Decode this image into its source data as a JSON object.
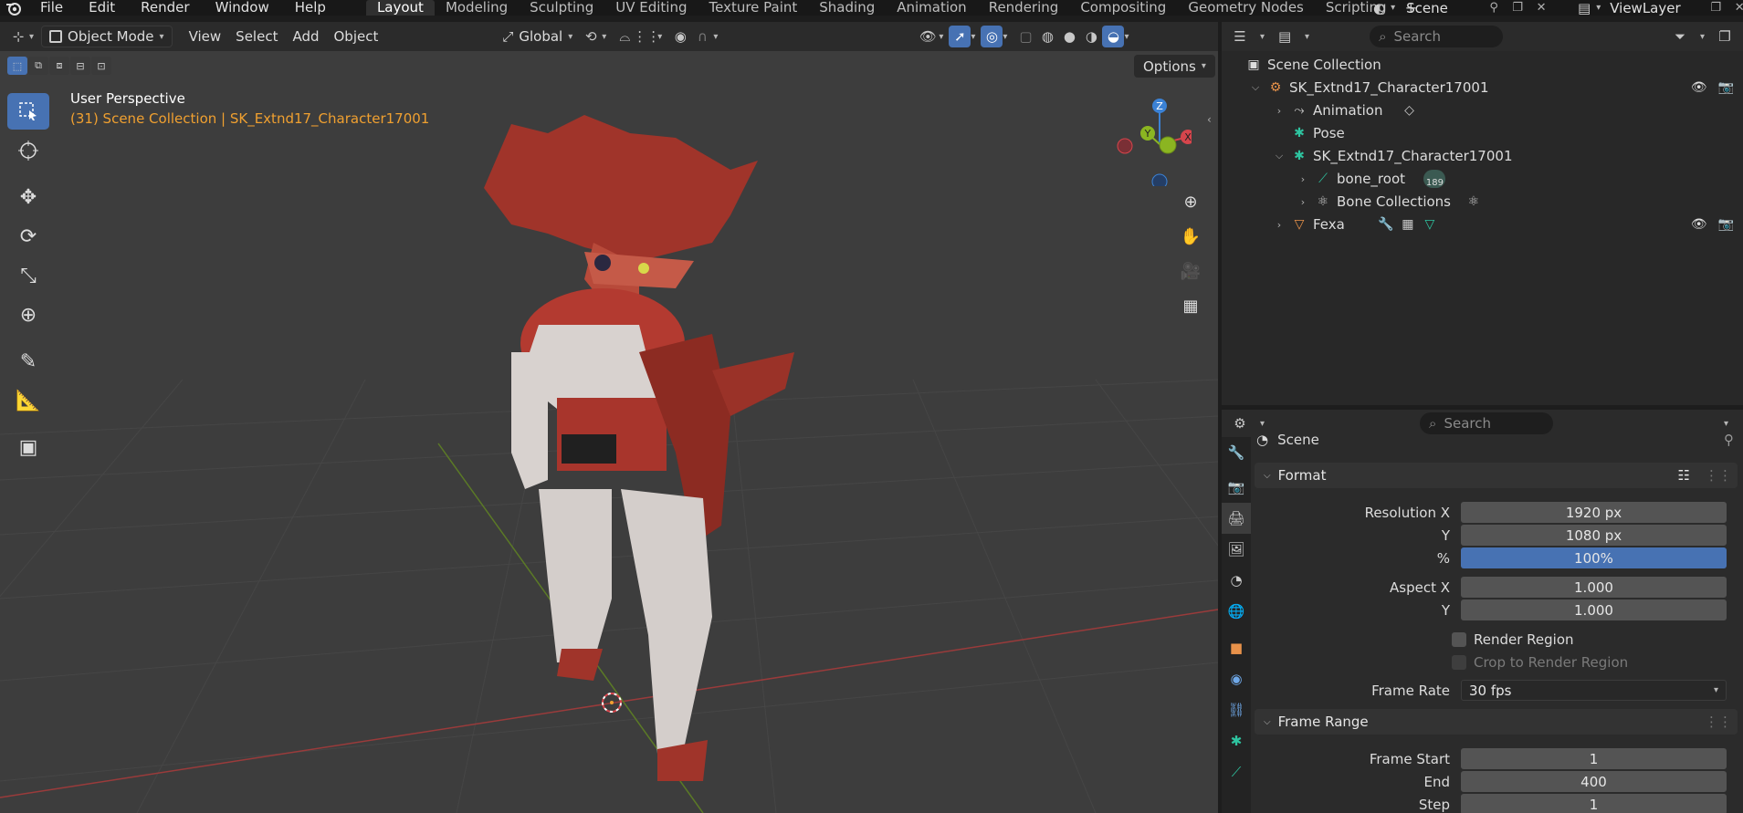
{
  "menubar": {
    "items": [
      "File",
      "Edit",
      "Render",
      "Window",
      "Help"
    ],
    "workspaces": [
      "Layout",
      "Modeling",
      "Sculpting",
      "UV Editing",
      "Texture Paint",
      "Shading",
      "Animation",
      "Rendering",
      "Compositing",
      "Geometry Nodes",
      "Scripting"
    ],
    "active_workspace": "Layout",
    "scene": "Scene",
    "view_layer": "ViewLayer"
  },
  "viewport": {
    "mode": "Object Mode",
    "menus": [
      "View",
      "Select",
      "Add",
      "Object"
    ],
    "orientation": "Global",
    "options_label": "Options",
    "info_line1": "User Perspective",
    "info_line2": "(31) Scene Collection | SK_Extnd17_Character17001",
    "gizmo": {
      "x": "X",
      "y": "Y",
      "z": "Z"
    }
  },
  "outliner": {
    "search_placeholder": "Search",
    "root": "Scene Collection",
    "rows": {
      "armature": "SK_Extnd17_Character17001",
      "animation": "Animation",
      "pose": "Pose",
      "armature_data": "SK_Extnd17_Character17001",
      "bone_root": "bone_root",
      "bone_root_badge": "189",
      "bone_collections": "Bone Collections",
      "mesh": "Fexa"
    }
  },
  "properties": {
    "search_placeholder": "Search",
    "context": "Scene",
    "format_title": "Format",
    "resolution_x_label": "Resolution X",
    "resolution_x": "1920 px",
    "resolution_y_label": "Y",
    "resolution_y": "1080 px",
    "percent_label": "%",
    "percent": "100%",
    "aspect_x_label": "Aspect X",
    "aspect_x": "1.000",
    "aspect_y_label": "Y",
    "aspect_y": "1.000",
    "render_region": "Render Region",
    "crop_region": "Crop to Render Region",
    "frame_rate_label": "Frame Rate",
    "frame_rate": "30 fps",
    "frame_range_title": "Frame Range",
    "frame_start_label": "Frame Start",
    "frame_start": "1",
    "end_label": "End",
    "end": "400",
    "step_label": "Step",
    "step": "1"
  },
  "colors": {
    "accent": "#4772b3",
    "orange": "#f0a030",
    "axis_x": "#d6454c",
    "axis_y": "#8bb521",
    "axis_z": "#3b82d6"
  }
}
